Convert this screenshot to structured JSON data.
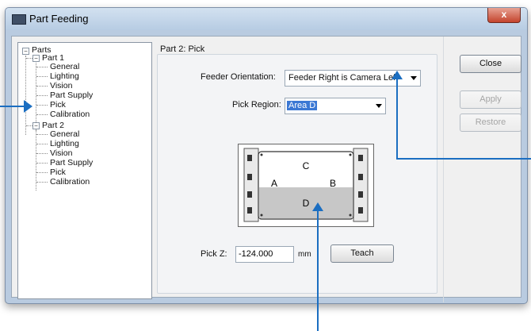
{
  "window": {
    "title": "Part Feeding",
    "close_glyph": "x"
  },
  "tree": {
    "root": "Parts",
    "parts": [
      {
        "label": "Part 1",
        "children": [
          "General",
          "Lighting",
          "Vision",
          "Part Supply",
          "Pick",
          "Calibration"
        ]
      },
      {
        "label": "Part 2",
        "children": [
          "General",
          "Lighting",
          "Vision",
          "Part Supply",
          "Pick",
          "Calibration"
        ]
      }
    ],
    "expand_glyph": "−"
  },
  "panel": {
    "title": "Part 2: Pick",
    "feeder_orientation": {
      "label": "Feeder Orientation:",
      "value": "Feeder Right is Camera Left"
    },
    "pick_region": {
      "label": "Pick Region:",
      "value": "Area D"
    },
    "diagram": {
      "areas": [
        "C",
        "A",
        "B",
        "D"
      ],
      "highlighted": "D"
    },
    "pick_z": {
      "label": "Pick Z:",
      "value": "-124.000",
      "unit": "mm"
    },
    "teach_button": "Teach"
  },
  "buttons": {
    "close": "Close",
    "apply": "Apply",
    "restore": "Restore"
  },
  "colors": {
    "accent": "#1b6ec1",
    "selection": "#3b78d4",
    "highlight_area": "#c7c7c7"
  },
  "icons": [
    "app-icon",
    "close-icon",
    "chevron-down-icon",
    "arrow-right-icon",
    "arrow-up-icon"
  ]
}
